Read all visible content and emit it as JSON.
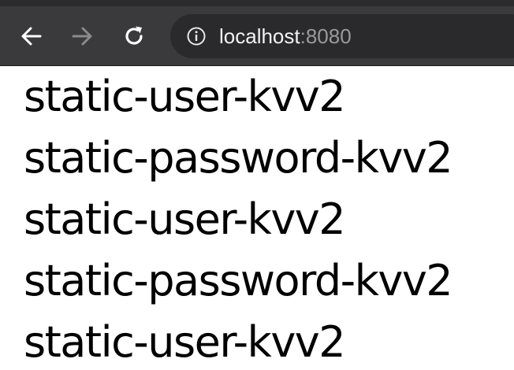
{
  "browser": {
    "back_icon": "arrow-left-icon",
    "forward_icon": "arrow-right-icon",
    "reload_icon": "reload-icon",
    "info_icon": "info-circle-icon",
    "url_host": "localhost",
    "url_port": ":8080"
  },
  "page": {
    "lines": [
      "static-user-kvv2",
      "static-password-kvv2",
      "static-user-kvv2",
      "static-password-kvv2",
      "static-user-kvv2"
    ]
  }
}
